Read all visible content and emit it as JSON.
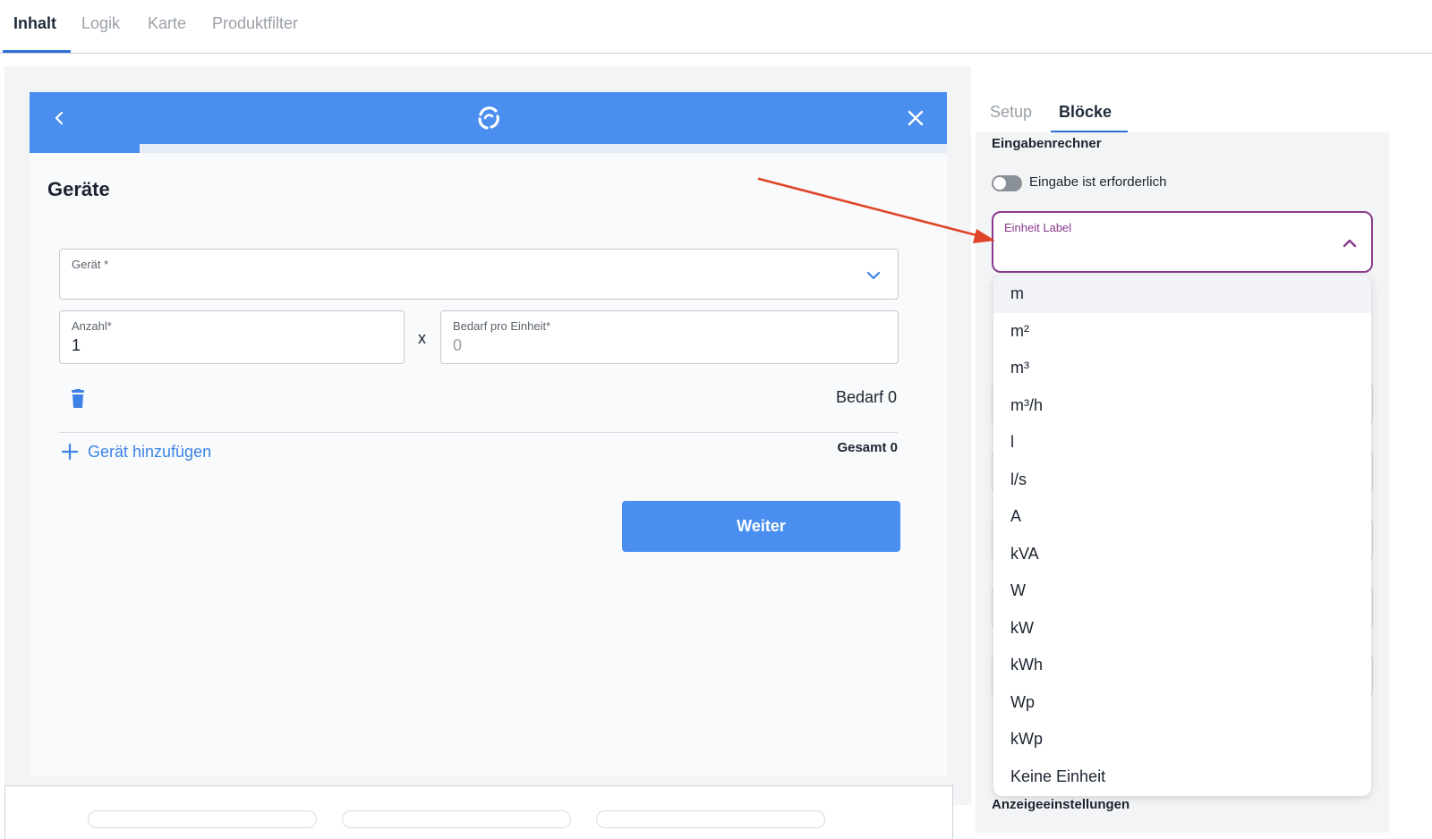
{
  "top_tabs": {
    "items": [
      {
        "label": "Inhalt",
        "active": true
      },
      {
        "label": "Logik",
        "active": false
      },
      {
        "label": "Karte",
        "active": false
      },
      {
        "label": "Produktfilter",
        "active": false
      }
    ]
  },
  "widget": {
    "header": {
      "back_icon": "chevron-left-icon",
      "logo_icon": "swirl-logo-icon",
      "close_icon": "close-icon",
      "color": "#4a8fef"
    },
    "progress": 0.12,
    "title": "Geräte",
    "geraet_field": {
      "label": "Gerät",
      "required_marker": "*",
      "value": ""
    },
    "anzahl_field": {
      "label": "Anzahl",
      "required_marker": "*",
      "value": "1"
    },
    "multiply_sign": "x",
    "bedarf_field": {
      "label": "Bedarf pro Einheit",
      "required_marker": "*",
      "placeholder": "0"
    },
    "bedarf_total": "Bedarf 0",
    "add_device_label": "Gerät hinzufügen",
    "gesamt_label": "Gesamt 0",
    "weiter_label": "Weiter"
  },
  "sidebar": {
    "tabs": [
      {
        "label": "Setup",
        "active": false
      },
      {
        "label": "Blöcke",
        "active": true
      }
    ],
    "section_title": "Eingabenrechner",
    "toggle": {
      "label": "Eingabe ist erforderlich",
      "on": false
    },
    "unit_select": {
      "label": "Einheit Label",
      "open": true,
      "accent": "#8b3a8f"
    },
    "dropdown_options": [
      "m",
      "m²",
      "m³",
      "m³/h",
      "l",
      "l/s",
      "A",
      "kVA",
      "W",
      "kW",
      "kWh",
      "Wp",
      "kWp",
      "Keine Einheit"
    ],
    "hovered_option_index": 0,
    "section_title_2": "Anzeigeeinstellungen"
  },
  "annotation": {
    "arrow_color": "#e0452a"
  }
}
